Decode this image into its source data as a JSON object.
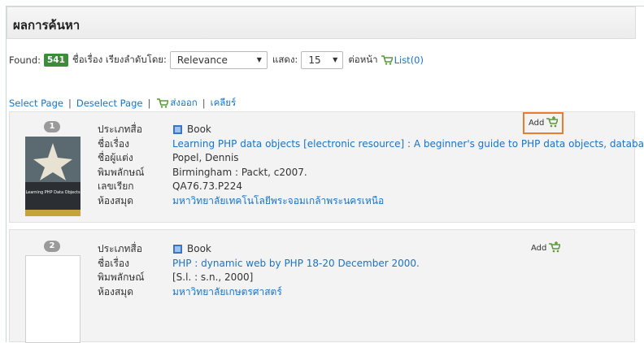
{
  "header": {
    "title": "ผลการค้นหา"
  },
  "search_bar": {
    "found_label": "Found:",
    "found_count": "541",
    "sort_label": "ชื่อเรื่อง เรียงลำดับโดย:",
    "sort_value": "Relevance",
    "show_label": "แสดง:",
    "per_page_value": "15",
    "per_page_label": "ต่อหน้า",
    "list_label": "List(0)"
  },
  "actions": {
    "select_page": "Select Page",
    "deselect_page": "Deselect Page",
    "export": "ส่งออก",
    "clear": "เคลียร์",
    "sep": "|"
  },
  "results": [
    {
      "number": "1",
      "add_label": "Add",
      "labels": [
        "ประเภทสื่อ",
        "ชื่อเรื่อง",
        "ชื่อผู้แต่ง",
        "พิมพลักษณ์",
        "เลขเรียก",
        "ห้องสมุด"
      ],
      "type": "Book",
      "title": "Learning PHP data objects [electronic resource] : A beginner's guide to PHP data objects, database c...",
      "author": "Popel, Dennis",
      "imprint": "Birmingham : Packt, c2007.",
      "call_number": "QA76.73.P224",
      "library": "มหาวิทยาลัยเทคโนโลยีพระจอมเกล้าพระนครเหนือ",
      "cover_text": "Learning PHP Data Objects"
    },
    {
      "number": "2",
      "add_label": "Add",
      "labels": [
        "ประเภทสื่อ",
        "ชื่อเรื่อง",
        "พิมพลักษณ์",
        "ห้องสมุด"
      ],
      "type": "Book",
      "title": "PHP : dynamic web by PHP 18-20 December 2000.",
      "imprint": "[S.l. : s.n., 2000]",
      "library": "มหาวิทยาลัยเกษตรศาสตร์"
    }
  ],
  "icons": [
    "cart-icon",
    "book-icon",
    "add-cart-icon",
    "dropdown-arrow-icon"
  ],
  "colors": {
    "link": "#1a73c4",
    "badge": "#3d8b3d",
    "highlight": "#e87d2f",
    "result_bg": "#f3f3f3"
  }
}
